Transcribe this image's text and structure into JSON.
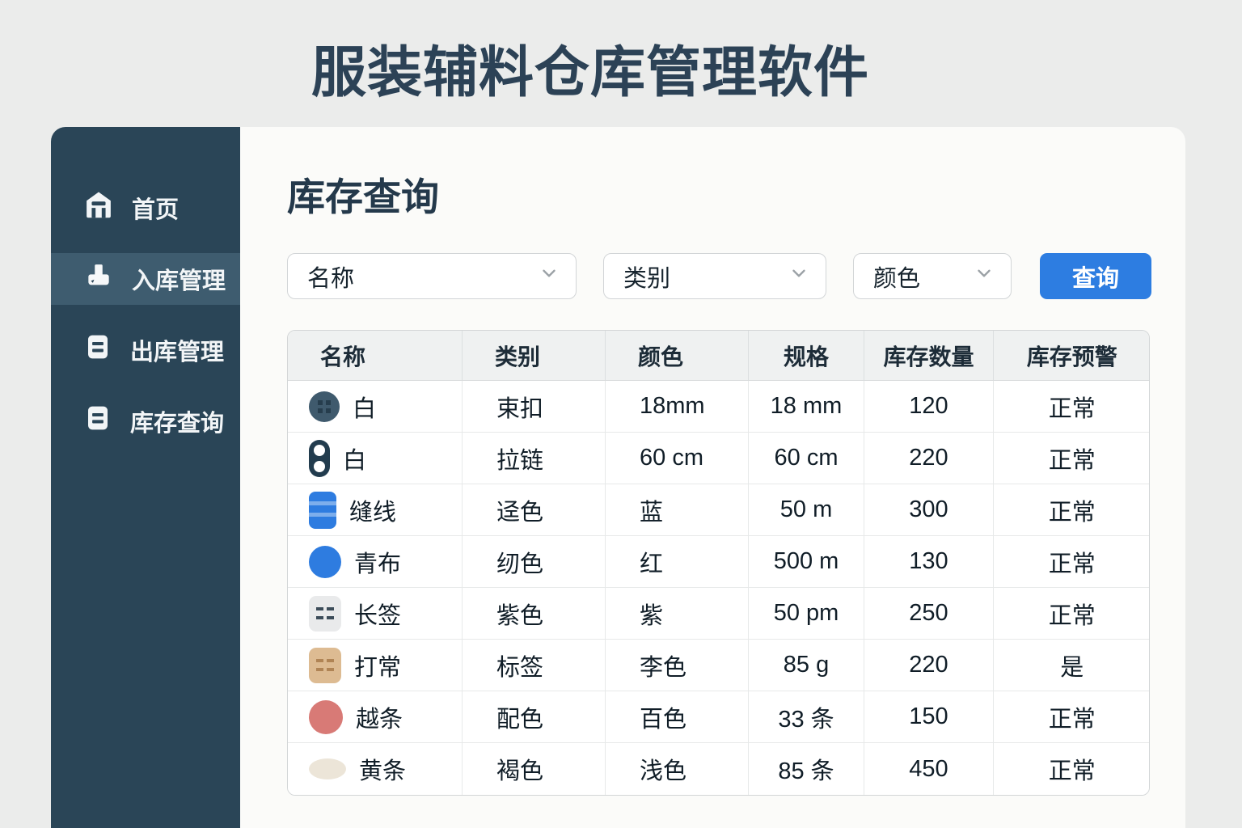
{
  "app": {
    "title": "服装辅料仓库管理软件"
  },
  "colors": {
    "accent_blue": "#2d7de1",
    "sidebar_bg": "#2a4557",
    "sidebar_active_bg": "#3e5c6f",
    "title_text": "#2c4256",
    "card_bg": "#fbfbf9",
    "table_header_bg": "#eff1f1"
  },
  "sidebar": {
    "items": [
      {
        "label": "首页",
        "icon": "home-icon",
        "active": false
      },
      {
        "label": "入库管理",
        "icon": "inbound-icon",
        "active": true
      },
      {
        "label": "出库管理",
        "icon": "outbound-doc-icon",
        "active": false
      },
      {
        "label": "库存查询",
        "icon": "inventory-doc-icon",
        "active": false
      }
    ]
  },
  "main": {
    "heading": "库存查询",
    "filters": [
      {
        "label": "名称"
      },
      {
        "label": "类别"
      },
      {
        "label": "颜色"
      }
    ],
    "query_button": "查询",
    "table": {
      "headers": [
        "名称",
        "类别",
        "颜色",
        "规格",
        "库存数量",
        "库存预警"
      ],
      "rows": [
        {
          "icon": "button-icon",
          "icon_color": "#3f5a6d",
          "name": "白",
          "category": "束扣",
          "color": "18mm",
          "spec": "18 mm",
          "qty": "120",
          "status": "正常"
        },
        {
          "icon": "zipper-icon",
          "icon_color": "#223c4e",
          "name": "白",
          "category": "拉链",
          "color": "60 cm",
          "spec": "60 cm",
          "qty": "220",
          "status": "正常"
        },
        {
          "icon": "thread-spool-icon",
          "icon_color": "#2e7ce0",
          "name": "缝线",
          "category": "迳色",
          "color": "蓝",
          "spec": "50 m",
          "qty": "300",
          "status": "正常"
        },
        {
          "icon": "fabric-roll-icon",
          "icon_color": "#2e7ce0",
          "name": "青布",
          "category": "纫色",
          "color": "红",
          "spec": "500 m",
          "qty": "130",
          "status": "正常"
        },
        {
          "icon": "label-icon",
          "icon_color": "#e9eaeb",
          "name": "长签",
          "category": "紫色",
          "color": "紫",
          "spec": "50 pm",
          "qty": "250",
          "status": "正常"
        },
        {
          "icon": "tag-icon",
          "icon_color": "#ddbb92",
          "name": "打常",
          "category": "标签",
          "color": "李色",
          "spec": "85 g",
          "qty": "220",
          "status": "是"
        },
        {
          "icon": "elastic-cord-icon",
          "icon_color": "#d87a76",
          "name": "越条",
          "category": "配色",
          "color": "百色",
          "spec": "33 条",
          "qty": "150",
          "status": "正常"
        },
        {
          "icon": "ribbon-icon",
          "icon_color": "#ece5d8",
          "name": "黄条",
          "category": "褐色",
          "color": "浅色",
          "spec": "85 条",
          "qty": "450",
          "status": "正常"
        }
      ]
    }
  }
}
